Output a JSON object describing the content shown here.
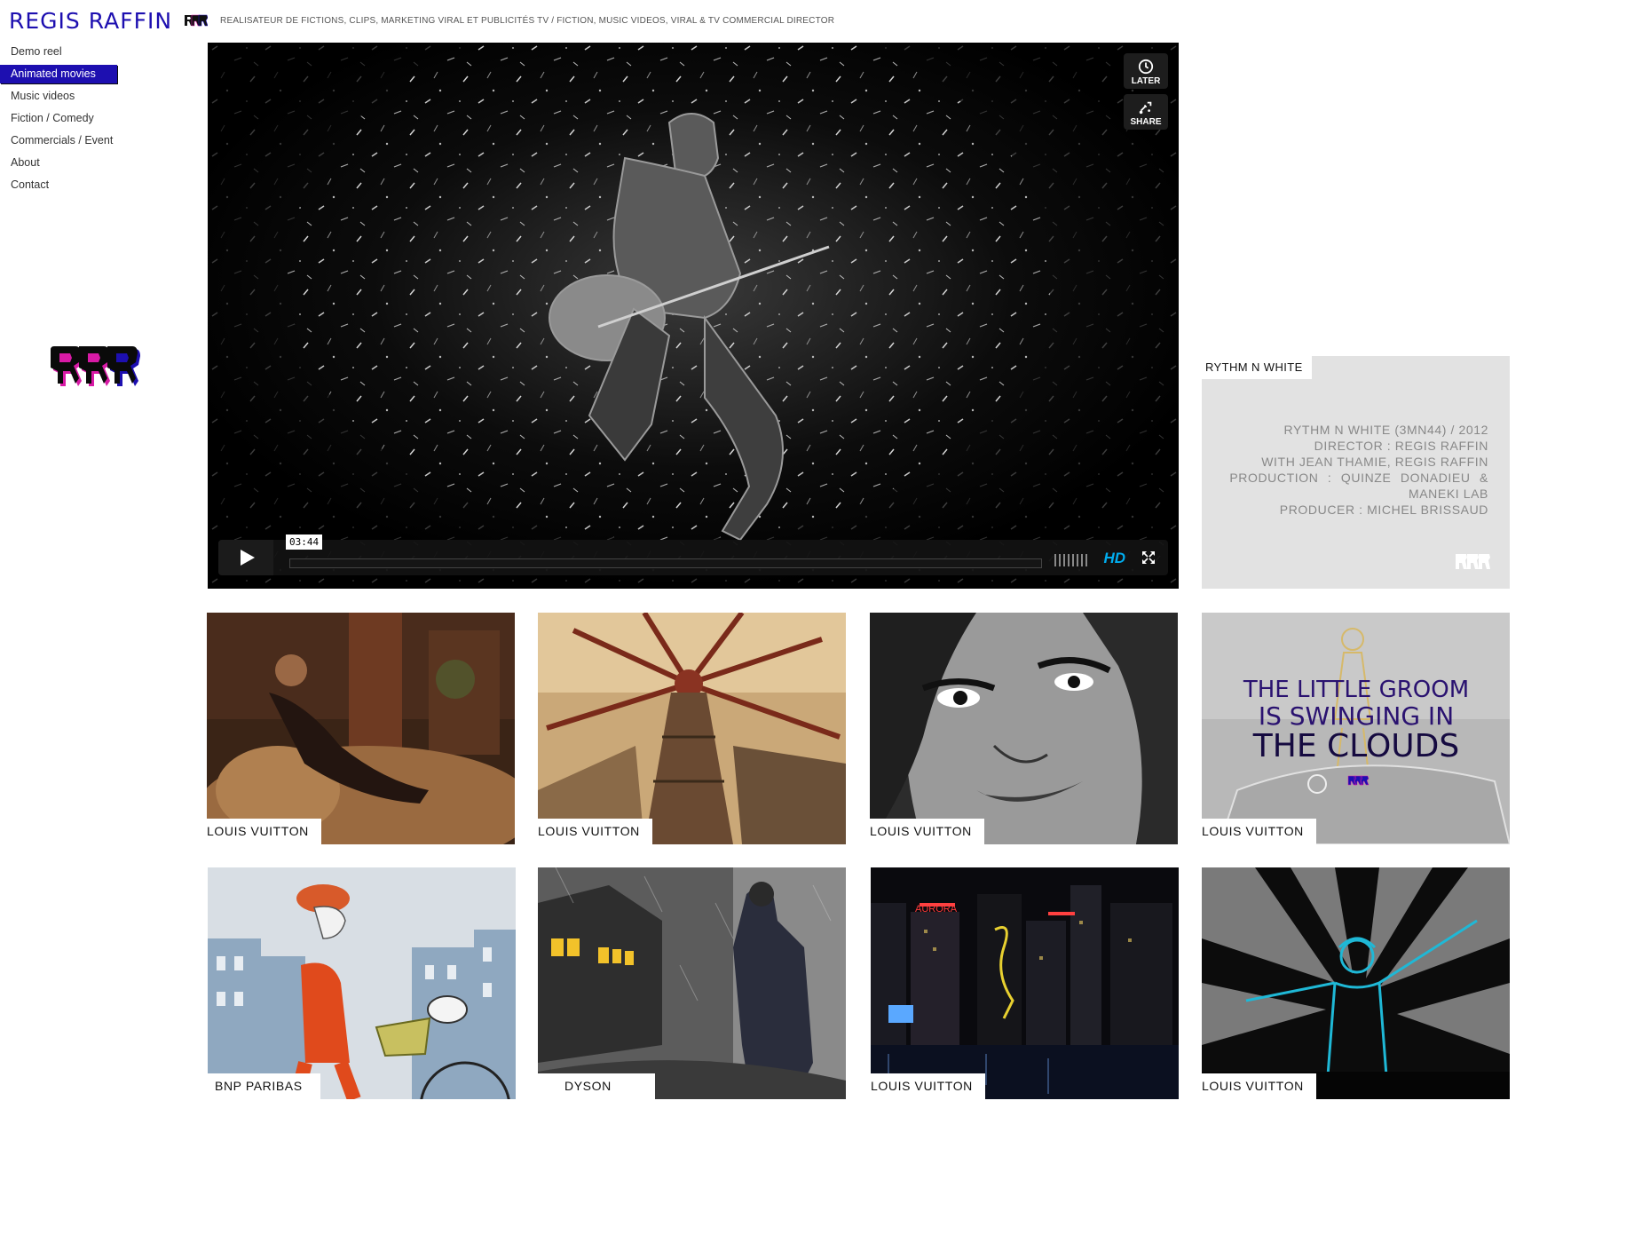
{
  "header": {
    "brand": "REGIS RAFFIN",
    "tagline": "REALISATEUR DE FICTIONS, CLIPS, MARKETING VIRAL ET PUBLICITÉS TV / FICTION, MUSIC VIDEOS, VIRAL & TV COMMERCIAL DIRECTOR"
  },
  "nav": {
    "items": [
      {
        "label": "Demo reel"
      },
      {
        "label": "Animated movies",
        "active": true
      },
      {
        "label": "Music videos"
      },
      {
        "label": "Fiction / Comedy"
      },
      {
        "label": "Commercials / Event"
      },
      {
        "label": "About"
      },
      {
        "label": "Contact"
      }
    ]
  },
  "video": {
    "later_label": "LATER",
    "share_label": "SHARE",
    "timecode": "03:44",
    "hd_label": "HD",
    "progress": 0
  },
  "info": {
    "title": "RYTHM N WHITE",
    "credits": [
      "RYTHM N WHITE (3MN44) / 2012",
      "DIRECTOR : REGIS RAFFIN",
      "WITH JEAN THAMIE, REGIS RAFFIN",
      "PRODUCTION : QUINZE DONADIEU &",
      "MANEKI LAB",
      "PRODUCER : MICHEL BRISSAUD"
    ]
  },
  "thumbnails": [
    {
      "label": "LOUIS VUITTON"
    },
    {
      "label": "LOUIS VUITTON"
    },
    {
      "label": "LOUIS VUITTON"
    },
    {
      "label": "LOUIS VUITTON",
      "overlay_text": [
        "THE LITTLE GROOM",
        "IS SWINGING IN",
        "THE CLOUDS"
      ]
    },
    {
      "label": "BNP PARIBAS"
    },
    {
      "label": "DYSON"
    },
    {
      "label": "LOUIS VUITTON",
      "overlay_text": [
        "AURORA"
      ]
    },
    {
      "label": "LOUIS VUITTON"
    }
  ],
  "colors": {
    "brand": "#1d0fb0",
    "hd": "#00adef",
    "panel": "#e2e2e2"
  },
  "icons": [
    "rrr-logo-icon",
    "clock-icon",
    "share-icon",
    "play-icon",
    "volume-icon",
    "fullscreen-icon"
  ]
}
